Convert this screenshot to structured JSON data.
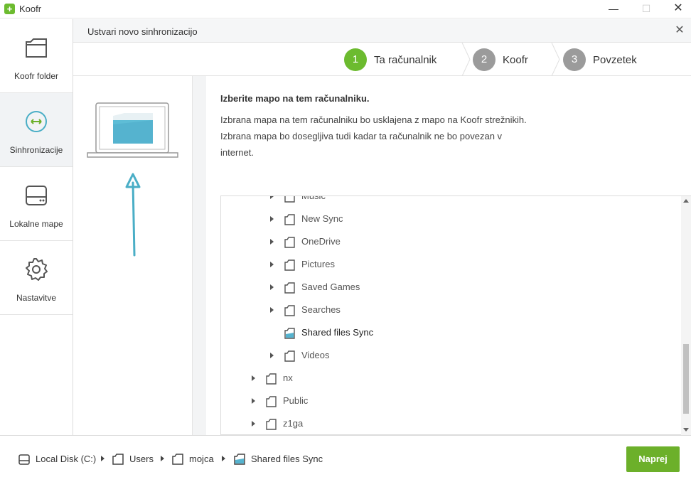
{
  "window": {
    "title": "Koofr",
    "minimize_glyph": "—",
    "maximize_glyph": "☐",
    "close_glyph": "✕"
  },
  "sidebar": {
    "items": [
      {
        "label": "Koofr folder",
        "icon": "folder-icon"
      },
      {
        "label": "Sinhronizacije",
        "icon": "sync-icon",
        "active": true
      },
      {
        "label": "Lokalne mape",
        "icon": "drive-icon"
      },
      {
        "label": "Nastavitve",
        "icon": "gear-icon"
      }
    ]
  },
  "dialog": {
    "title": "Ustvari novo sinhronizacijo",
    "close_glyph": "✕"
  },
  "steps": [
    {
      "number": "1",
      "label": "Ta računalnik",
      "active": true
    },
    {
      "number": "2",
      "label": "Koofr",
      "active": false
    },
    {
      "number": "3",
      "label": "Povzetek",
      "active": false
    }
  ],
  "content": {
    "heading": "Izberite mapo na tem računalniku.",
    "description": "Izbrana mapa na tem računalniku bo usklajena z mapo na Koofr strežnikih. Izbrana mapa bo dosegljiva tudi kadar ta računalnik ne bo povezan v internet."
  },
  "tree": {
    "rows": [
      {
        "label": "Music",
        "level": 2,
        "expandable": true
      },
      {
        "label": "New Sync",
        "level": 2,
        "expandable": true
      },
      {
        "label": "OneDrive",
        "level": 2,
        "expandable": true
      },
      {
        "label": "Pictures",
        "level": 2,
        "expandable": true
      },
      {
        "label": "Saved Games",
        "level": 2,
        "expandable": true
      },
      {
        "label": "Searches",
        "level": 2,
        "expandable": true
      },
      {
        "label": "Shared files Sync",
        "level": 2,
        "expandable": false,
        "selected": true
      },
      {
        "label": "Videos",
        "level": 2,
        "expandable": true
      },
      {
        "label": "nx",
        "level": 1,
        "expandable": true
      },
      {
        "label": "Public",
        "level": 1,
        "expandable": true
      },
      {
        "label": "z1ga",
        "level": 1,
        "expandable": true
      }
    ]
  },
  "breadcrumb": [
    {
      "label": "Local Disk (C:)",
      "icon": "drive-icon"
    },
    {
      "label": "Users",
      "icon": "folder-icon"
    },
    {
      "label": "mojca",
      "icon": "folder-icon"
    },
    {
      "label": "Shared files Sync",
      "icon": "folder-selected-icon"
    }
  ],
  "footer": {
    "next_label": "Naprej"
  },
  "colors": {
    "accent": "#6cb02a",
    "step_active": "#6cbb2f",
    "step_inactive": "#9b9b9b",
    "folder_selected": "#55b3cf"
  }
}
